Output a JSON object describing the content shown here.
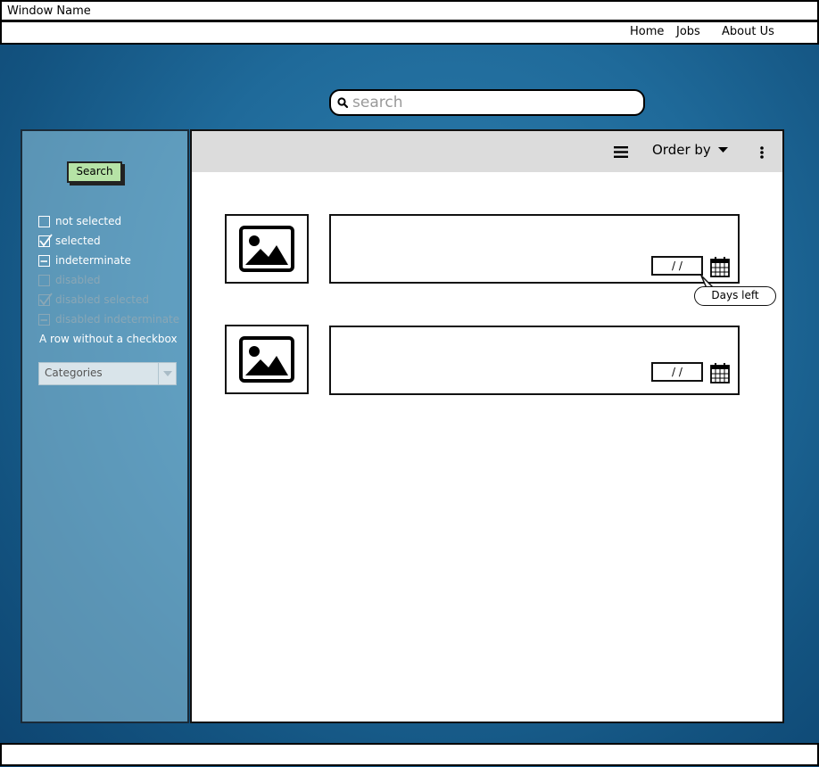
{
  "window": {
    "title": "Window Name"
  },
  "nav": {
    "items": [
      "Home",
      "Jobs",
      "About Us"
    ]
  },
  "search": {
    "placeholder": "search"
  },
  "sidebar": {
    "search_label": "Search",
    "checkboxes": [
      {
        "label": "not selected",
        "state": "unchecked",
        "disabled": false
      },
      {
        "label": "selected",
        "state": "checked",
        "disabled": false
      },
      {
        "label": "indeterminate",
        "state": "indeterminate",
        "disabled": false
      },
      {
        "label": "disabled",
        "state": "unchecked",
        "disabled": true
      },
      {
        "label": "disabled selected",
        "state": "checked",
        "disabled": true
      },
      {
        "label": "disabled indeterminate",
        "state": "indeterminate",
        "disabled": true
      }
    ],
    "row_without_checkbox": "A row without a checkbox",
    "categories": {
      "selected": "Categories"
    }
  },
  "toolbar": {
    "menu_icon": "hamburger-icon",
    "order_by_label": "Order by",
    "more_icon": "kebab-icon"
  },
  "results": [
    {
      "image_icon": "image-placeholder-icon",
      "date": "/ /",
      "calendar_icon": "calendar-icon"
    },
    {
      "image_icon": "image-placeholder-icon",
      "date": "/ /",
      "calendar_icon": "calendar-icon"
    }
  ],
  "tooltip": {
    "text": "Days left"
  }
}
